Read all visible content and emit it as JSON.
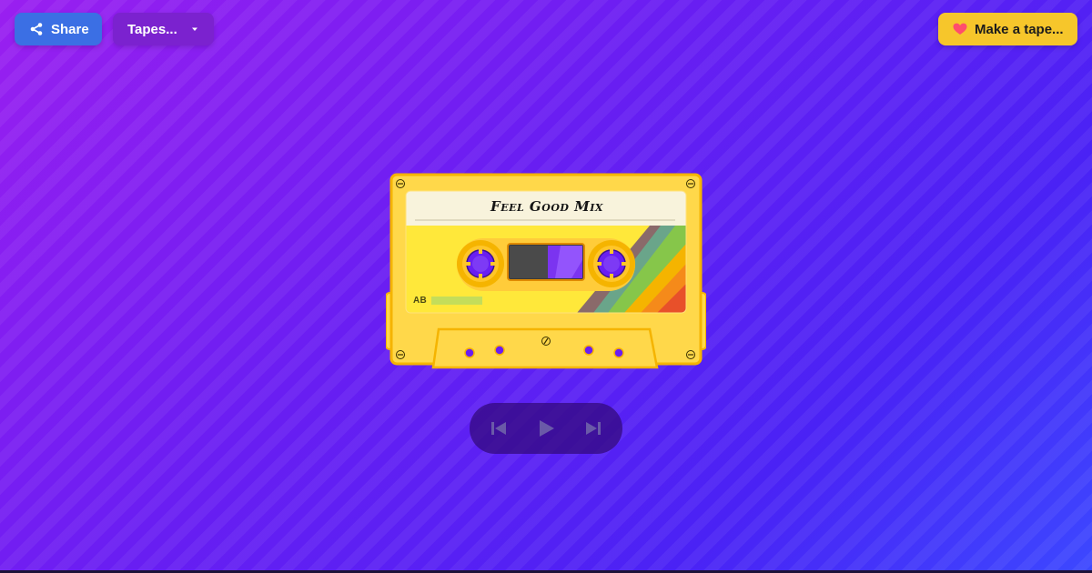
{
  "toolbar": {
    "share_label": "Share",
    "tapes_label": "Tapes...",
    "make_tape_label": "Make a tape..."
  },
  "tape": {
    "title": "Feel Good Mix",
    "side_label": "AB"
  },
  "icons": {
    "share": "share-icon",
    "tapes_dropdown": "caret-down-icon",
    "make_tape": "heart-icon",
    "previous": "skip-previous-icon",
    "play": "play-icon",
    "next": "skip-next-icon"
  },
  "colors": {
    "share_button": "#3b6fe4",
    "tapes_button": "#7b22cf",
    "make_tape_button": "#f6c62b",
    "heart": "#ff4d6d",
    "cassette_body": "#ffd84a",
    "cassette_outline": "#f5b400",
    "label_paper": "#f8f3dc",
    "reel_hub": "#6a1ef2"
  }
}
